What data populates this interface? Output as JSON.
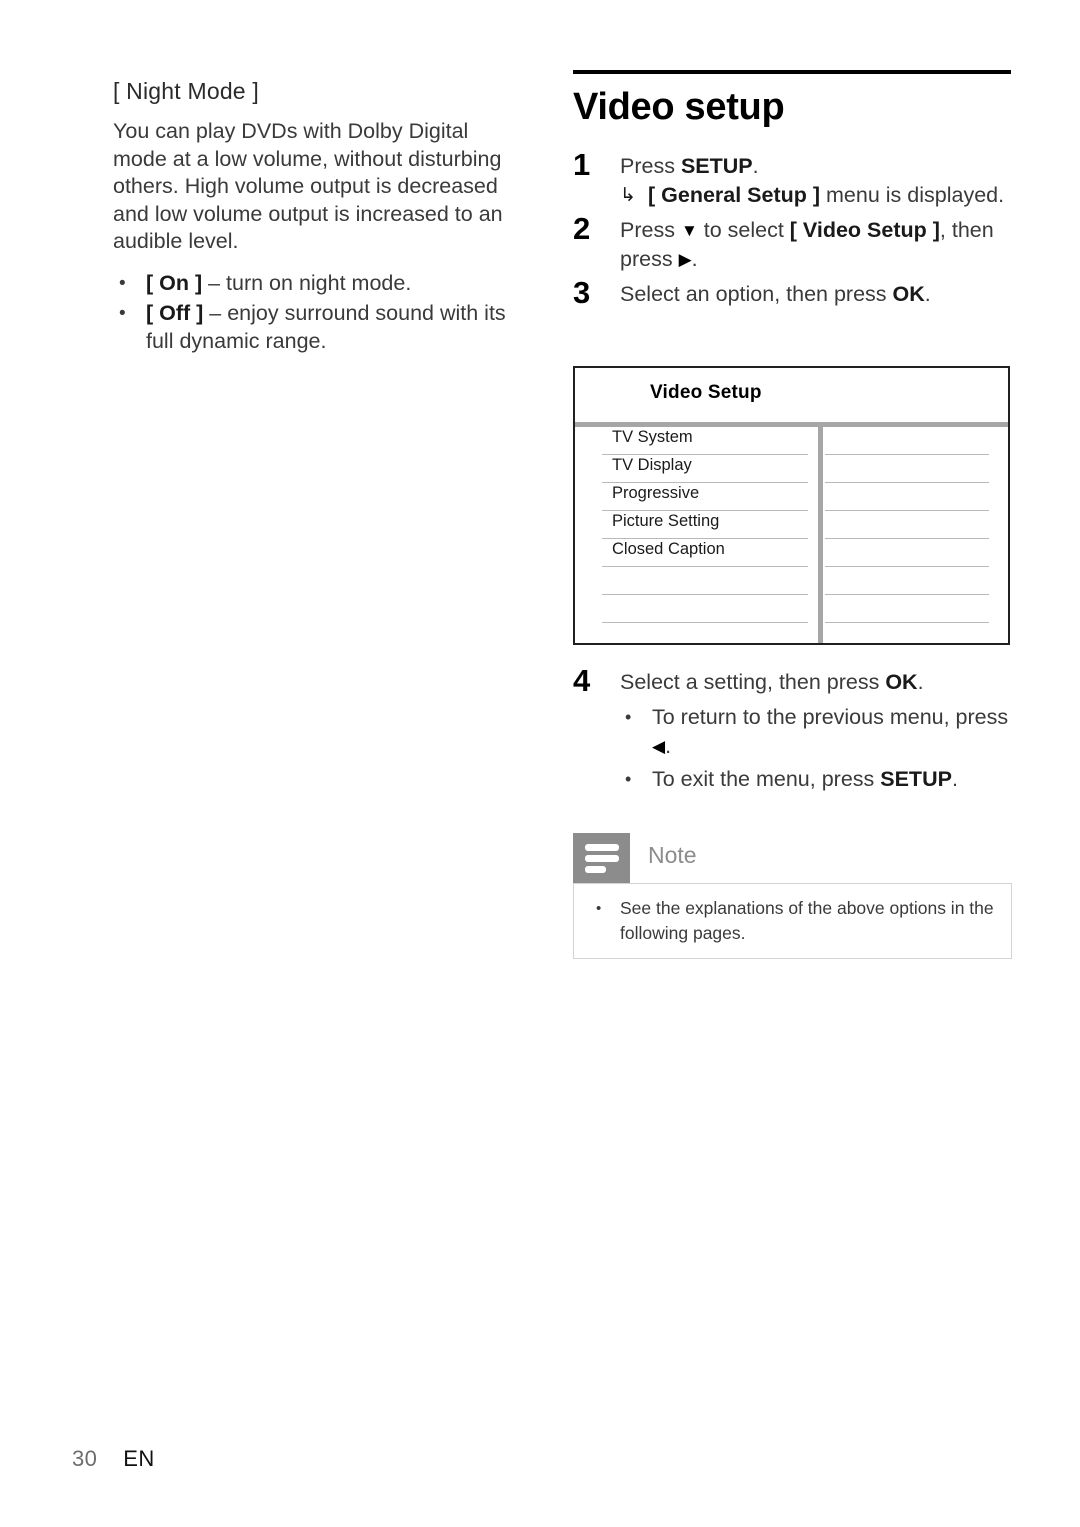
{
  "page": {
    "footer_page_number": "30",
    "footer_language": "EN"
  },
  "left_column": {
    "subheading": "[ Night Mode ]",
    "paragraph": "You can play DVDs with Dolby Digital mode at a low volume, without disturbing others. High volume output is decreased and low volume output is increased to an audible level.",
    "bullets": [
      {
        "term": "[ On ]",
        "rest": " – turn on night mode."
      },
      {
        "term": "[ Off ]",
        "rest": " – enjoy surround sound with its full dynamic range."
      }
    ]
  },
  "right_column": {
    "section_title": "Video setup",
    "steps": [
      {
        "number": "1",
        "text_before": "Press ",
        "key": "SETUP",
        "text_after": ".",
        "substep_arrow": "↳",
        "substep_term": "[ General Setup ]",
        "substep_rest": " menu is displayed."
      },
      {
        "number": "2",
        "line1_before": "Press ",
        "down_arrow": "▼",
        "line1_mid": " to select ",
        "term": "[ Video Setup ]",
        "line1_after": ", then",
        "line2_before": "press ",
        "right_arrow": "▶",
        "line2_after": "."
      },
      {
        "number": "3",
        "text_before": "Select an option, then press ",
        "key": "OK",
        "text_after": "."
      },
      {
        "number": "4",
        "text_before": "Select a setting, then press ",
        "key": "OK",
        "text_after": ".",
        "bullets": [
          {
            "before": "To return to the previous menu, press ",
            "glyph": "◀",
            "after": "."
          },
          {
            "before": "To exit the menu, press ",
            "key": "SETUP",
            "after": "."
          }
        ]
      }
    ]
  },
  "video_setup_screen": {
    "title": "Video Setup",
    "rows": [
      {
        "label": "TV System",
        "value": ""
      },
      {
        "label": "TV Display",
        "value": ""
      },
      {
        "label": "Progressive",
        "value": ""
      },
      {
        "label": "Picture Setting",
        "value": ""
      },
      {
        "label": "Closed Caption",
        "value": ""
      },
      {
        "label": "",
        "value": ""
      },
      {
        "label": "",
        "value": ""
      },
      {
        "label": "",
        "value": ""
      }
    ]
  },
  "note_box": {
    "icon": "note-lines-icon",
    "label": "Note",
    "items": [
      "See the explanations of the above options in the following pages."
    ]
  },
  "colors": {
    "text": "#3a3a3a",
    "heading": "#000000",
    "note_gray": "#8c8c8c",
    "rule_gray": "#a6a6a6",
    "row_rule": "#b9b9b9",
    "border": "#d3d3d3"
  }
}
